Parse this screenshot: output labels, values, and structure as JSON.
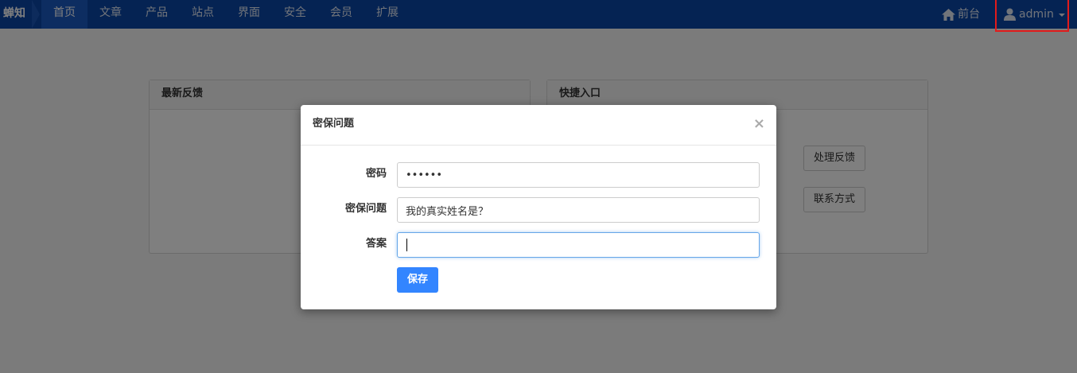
{
  "navbar": {
    "brand": "蝉知",
    "items": [
      {
        "label": "首页",
        "active": true
      },
      {
        "label": "文章"
      },
      {
        "label": "产品"
      },
      {
        "label": "站点"
      },
      {
        "label": "界面"
      },
      {
        "label": "安全"
      },
      {
        "label": "会员"
      },
      {
        "label": "扩展"
      }
    ],
    "home_label": "前台",
    "home_icon": "home-icon",
    "user_label": "admin",
    "user_icon": "user-icon"
  },
  "panels": {
    "left_title": "最新反馈",
    "right_title": "快捷入口",
    "quick_buttons": [
      "处理反馈",
      "联系方式"
    ]
  },
  "modal": {
    "title": "密保问题",
    "close_symbol": "×",
    "fields": {
      "password_label": "密码",
      "password_value": "••••••",
      "question_label": "密保问题",
      "question_value": "我的真实姓名是？",
      "answer_label": "答案",
      "answer_value": ""
    },
    "save_label": "保存"
  },
  "colors": {
    "navbar_bg": "#0b47a7",
    "primary_button": "#3385ff",
    "highlight_box": "#e21b1b"
  }
}
